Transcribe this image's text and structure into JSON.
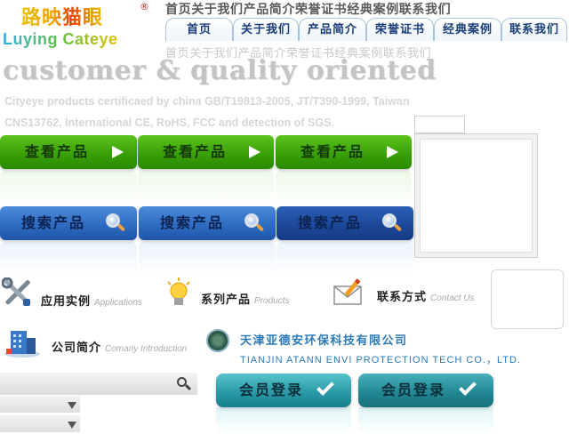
{
  "logo": {
    "cn": "路映猫眼",
    "reg": "®",
    "en": "Luying Cateye"
  },
  "ghost_nav": {
    "top": "首页关于我们产品简介荣誉证书经典案例联系我们",
    "bottom": "首页关于我们产品简介荣誉证书经典案例联系我们"
  },
  "nav": {
    "tabs": [
      {
        "label": "首页"
      },
      {
        "label": "关于我们"
      },
      {
        "label": "产品简介"
      },
      {
        "label": "荣誉证书"
      },
      {
        "label": "经典案例"
      },
      {
        "label": "联系我们"
      }
    ]
  },
  "hero": {
    "title": "customer & quality oriented",
    "sub_line1": "Cityeye products certificaed by china  GB/T19813-2005, JT/T390-1999,  Taiwan",
    "sub_line2": "CNS13762,  International CE, RoHS, FCC and detection of SGS."
  },
  "buttons": {
    "view_products": "查看产品",
    "search_products": "搜索产品",
    "member_login": "会员登录"
  },
  "sections": {
    "applications": {
      "cn": "应用实例",
      "en": "Applications"
    },
    "products": {
      "cn": "系列产品",
      "en": "Products"
    },
    "contact": {
      "cn": "联系方式",
      "en": "Contact Us"
    },
    "company": {
      "cn": "公司简介",
      "en": "Comany Introduction"
    }
  },
  "company": {
    "name_cn": "天津亚德安环保科技有限公司",
    "name_en": "TIANJIN ATANN ENVI PROTECTION TECH CO.，LTD."
  },
  "colors": {
    "nav_text": "#1a3e7a",
    "green_button": "#3aa008",
    "blue_button": "#2f6cc2",
    "teal_button": "#2a9aa8",
    "company_blue": "#2a7ab8"
  }
}
